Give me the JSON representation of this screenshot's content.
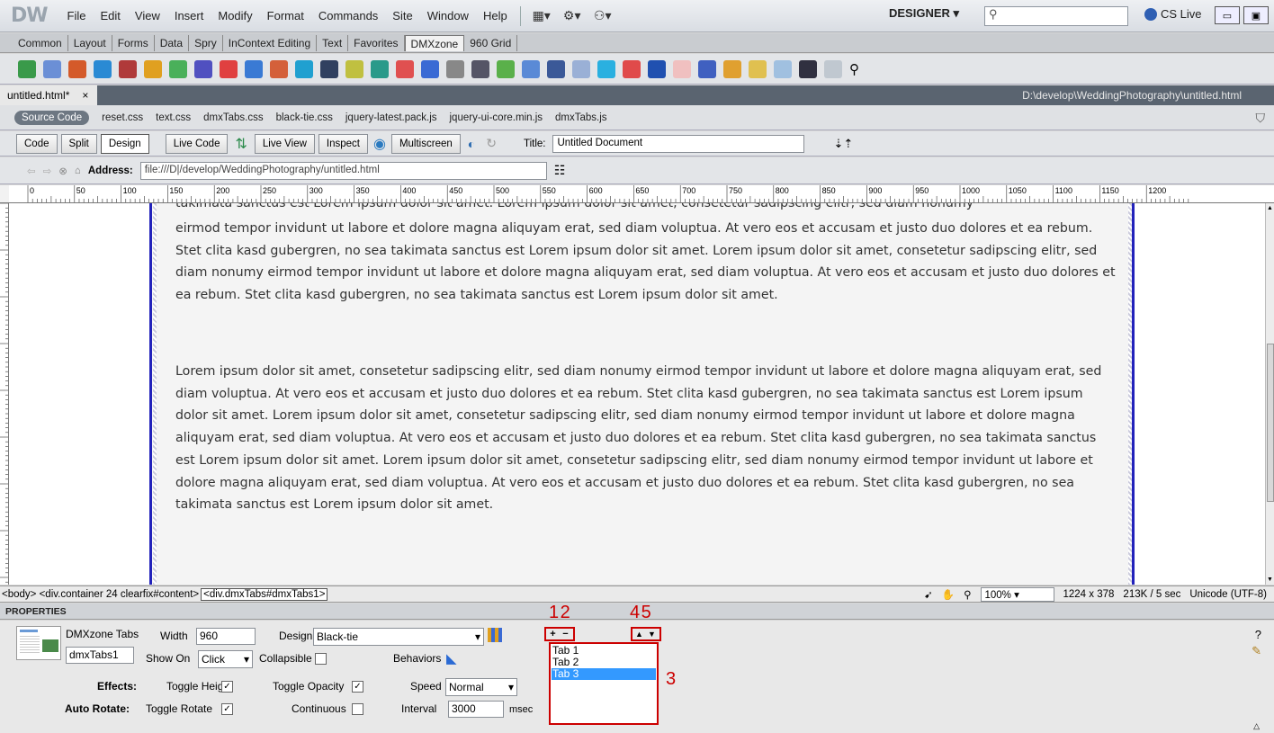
{
  "app": {
    "logo": "DW",
    "workspace": "DESIGNER",
    "cs_live": "CS Live"
  },
  "menu": [
    "File",
    "Edit",
    "View",
    "Insert",
    "Modify",
    "Format",
    "Commands",
    "Site",
    "Window",
    "Help"
  ],
  "insert_tabs": [
    "Common",
    "Layout",
    "Forms",
    "Data",
    "Spry",
    "InContext Editing",
    "Text",
    "Favorites",
    "DMXzone",
    "960 Grid"
  ],
  "insert_tabs_active": "DMXzone",
  "document": {
    "tab_name": "untitled.html*",
    "close": "×",
    "path": "D:\\develop\\WeddingPhotography\\untitled.html"
  },
  "related_files": [
    "Source Code",
    "reset.css",
    "text.css",
    "dmxTabs.css",
    "black-tie.css",
    "jquery-latest.pack.js",
    "jquery-ui-core.min.js",
    "dmxTabs.js"
  ],
  "doc_toolbar": {
    "code": "Code",
    "split": "Split",
    "design": "Design",
    "live_code": "Live Code",
    "live_view": "Live View",
    "inspect": "Inspect",
    "multiscreen": "Multiscreen",
    "title_label": "Title:",
    "title_value": "Untitled Document"
  },
  "browser": {
    "address_label": "Address:",
    "address_value": "file:///D|/develop/WeddingPhotography/untitled.html"
  },
  "ruler": {
    "marks": [
      "0",
      "50",
      "100",
      "150",
      "200",
      "250",
      "300",
      "350",
      "400",
      "450",
      "500",
      "550",
      "600",
      "650",
      "700",
      "750",
      "800",
      "850",
      "900",
      "950",
      "1000",
      "1050",
      "1100",
      "1150",
      "1200"
    ]
  },
  "content": {
    "partial_top": "takimata sanctus est Lorem ipsum dolor sit amet. Lorem ipsum dolor sit amet, consetetur sadipscing elitr, sed diam nonumy",
    "para1": "eirmod tempor invidunt ut labore et dolore magna aliquyam erat, sed diam voluptua. At vero eos et accusam et justo duo dolores et ea rebum. Stet clita kasd gubergren, no sea takimata sanctus est Lorem ipsum dolor sit amet. Lorem ipsum dolor sit amet, consetetur sadipscing elitr, sed diam nonumy eirmod tempor invidunt ut labore et dolore magna aliquyam erat, sed diam voluptua. At vero eos et accusam et justo duo dolores et ea rebum. Stet clita kasd gubergren, no sea takimata sanctus est Lorem ipsum dolor sit amet.",
    "para2": "Lorem ipsum dolor sit amet, consetetur sadipscing elitr, sed diam nonumy eirmod tempor invidunt ut labore et dolore magna aliquyam erat, sed diam voluptua. At vero eos et accusam et justo duo dolores et ea rebum. Stet clita kasd gubergren, no sea takimata sanctus est Lorem ipsum dolor sit amet. Lorem ipsum dolor sit amet, consetetur sadipscing elitr, sed diam nonumy eirmod tempor invidunt ut labore et dolore magna aliquyam erat, sed diam voluptua. At vero eos et accusam et justo duo dolores et ea rebum. Stet clita kasd gubergren, no sea takimata sanctus est Lorem ipsum dolor sit amet. Lorem ipsum dolor sit amet, consetetur sadipscing elitr, sed diam nonumy eirmod tempor invidunt ut labore et dolore magna aliquyam erat, sed diam voluptua. At vero eos et accusam et justo duo dolores et ea rebum. Stet clita kasd gubergren, no sea takimata sanctus est Lorem ipsum dolor sit amet."
  },
  "status": {
    "tag_body": "<body>",
    "tag_container": "<div.container",
    "tag_clearfix": "24 clearfix#content>",
    "tag_active": "<div.dmxTabs#dmxTabs1>",
    "zoom": "100%",
    "dims": "1224 x 378",
    "size": "213K / 5 sec",
    "encoding": "Unicode (UTF-8)"
  },
  "properties": {
    "header": "PROPERTIES",
    "component": "DMXzone Tabs",
    "id": "dmxTabs1",
    "width_label": "Width",
    "width_value": "960",
    "design_label": "Design",
    "design_value": "Black-tie",
    "show_on_label": "Show On",
    "show_on_value": "Click",
    "collapsible_label": "Collapsible",
    "behaviors_label": "Behaviors",
    "effects_label": "Effects:",
    "toggle_height": "Toggle Height",
    "toggle_opacity": "Toggle Opacity",
    "speed_label": "Speed",
    "speed_value": "Normal",
    "auto_rotate_label": "Auto Rotate:",
    "toggle_rotate": "Toggle Rotate",
    "continuous": "Continuous",
    "interval_label": "Interval",
    "interval_value": "3000",
    "interval_unit": "msec",
    "tabs": [
      "Tab 1",
      "Tab 2",
      "Tab 3"
    ],
    "checked": "✓",
    "add": "+",
    "remove": "−",
    "up": "▲",
    "down": "▼"
  },
  "annotations": {
    "n12": "1 2",
    "n45": "4 5",
    "n3": "3"
  }
}
